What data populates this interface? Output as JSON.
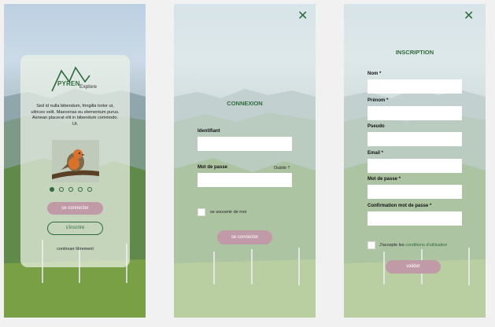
{
  "colors": {
    "brand_green": "#2e6b3c",
    "button_pink": "#c19aa8"
  },
  "splash": {
    "logo_word": "PYREN",
    "logo_sub": "Explore",
    "description": "Sed id nulla bibendum, fringilla tortor ut, ultrices velit. Maecenas eu elementum purus. Aenean placerat elit in bibendum commodo. Ut.",
    "image_icon": "robin-bird-photo",
    "carousel_pages": 5,
    "carousel_active": 1,
    "login_label": "se connecter",
    "register_label": "s'inscrire",
    "continue_label": "continuer librement"
  },
  "login": {
    "close_icon": "close-icon",
    "title": "CONNEXION",
    "identifier_label": "Identifiant",
    "identifier_value": "",
    "password_label": "Mot de passe",
    "password_value": "",
    "forgot_label": "Oublié ?",
    "remember_label": "se souvenir de moi",
    "submit_label": "se connecter"
  },
  "signup": {
    "close_icon": "close-icon",
    "title": "INSCRIPTION",
    "fields": [
      {
        "label": "Nom *",
        "value": ""
      },
      {
        "label": "Prénom *",
        "value": ""
      },
      {
        "label": "Pseudo",
        "value": ""
      },
      {
        "label": "Email *",
        "value": ""
      },
      {
        "label": "Mot de passe *",
        "value": ""
      },
      {
        "label": "Confirmation mot de passe *",
        "value": ""
      }
    ],
    "terms_prefix": "J'accepte les",
    "terms_link": "conditions d'utilisation",
    "submit_label": "valider"
  }
}
